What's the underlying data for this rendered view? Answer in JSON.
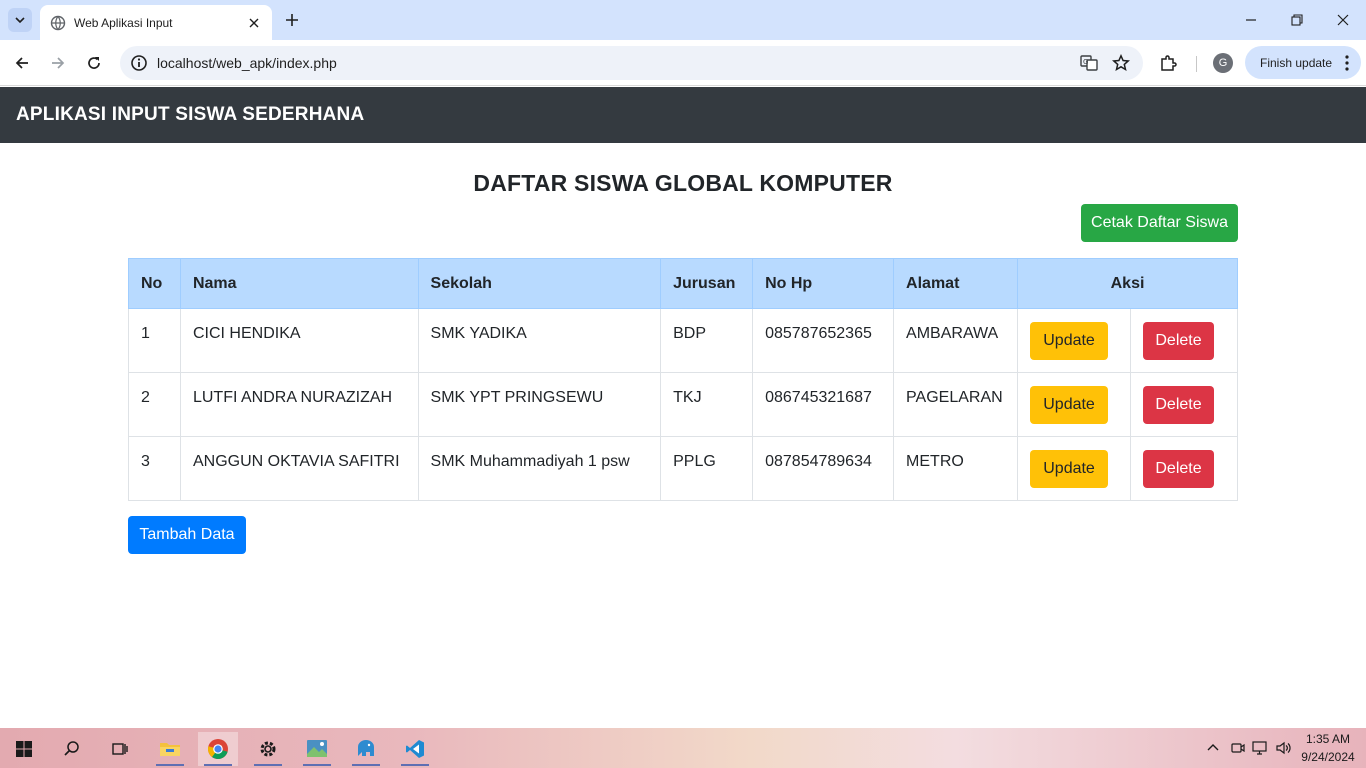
{
  "browser": {
    "tab_title": "Web Aplikasi Input",
    "url": "localhost/web_apk/index.php",
    "profile_initial": "G",
    "finish_update_label": "Finish update"
  },
  "app": {
    "brand": "APLIKASI INPUT SISWA SEDERHANA",
    "page_title": "DAFTAR SISWA GLOBAL KOMPUTER",
    "print_button": "Cetak Daftar Siswa",
    "add_button": "Tambah Data"
  },
  "table": {
    "headers": [
      "No",
      "Nama",
      "Sekolah",
      "Jurusan",
      "No Hp",
      "Alamat",
      "Aksi"
    ],
    "rows": [
      {
        "no": "1",
        "nama": "CICI HENDIKA",
        "sekolah": "SMK YADIKA",
        "jurusan": "BDP",
        "hp": "085787652365",
        "alamat": "AMBARAWA"
      },
      {
        "no": "2",
        "nama": "LUTFI ANDRA NURAZIZAH",
        "sekolah": "SMK YPT PRINGSEWU",
        "jurusan": "TKJ",
        "hp": "086745321687",
        "alamat": "PAGELARAN"
      },
      {
        "no": "3",
        "nama": "ANGGUN OKTAVIA SAFITRI",
        "sekolah": "SMK Muhammadiyah 1 psw",
        "jurusan": "PPLG",
        "hp": "087854789634",
        "alamat": "METRO"
      }
    ],
    "update_label": "Update",
    "delete_label": "Delete"
  },
  "taskbar": {
    "time": "1:35 AM",
    "date": "9/24/2024"
  },
  "colors": {
    "navbar": "#343a40",
    "print_button": "#28a745",
    "add_button": "#007bff",
    "update_button": "#ffc107",
    "delete_button": "#dc3545",
    "table_header": "#b8daff"
  }
}
